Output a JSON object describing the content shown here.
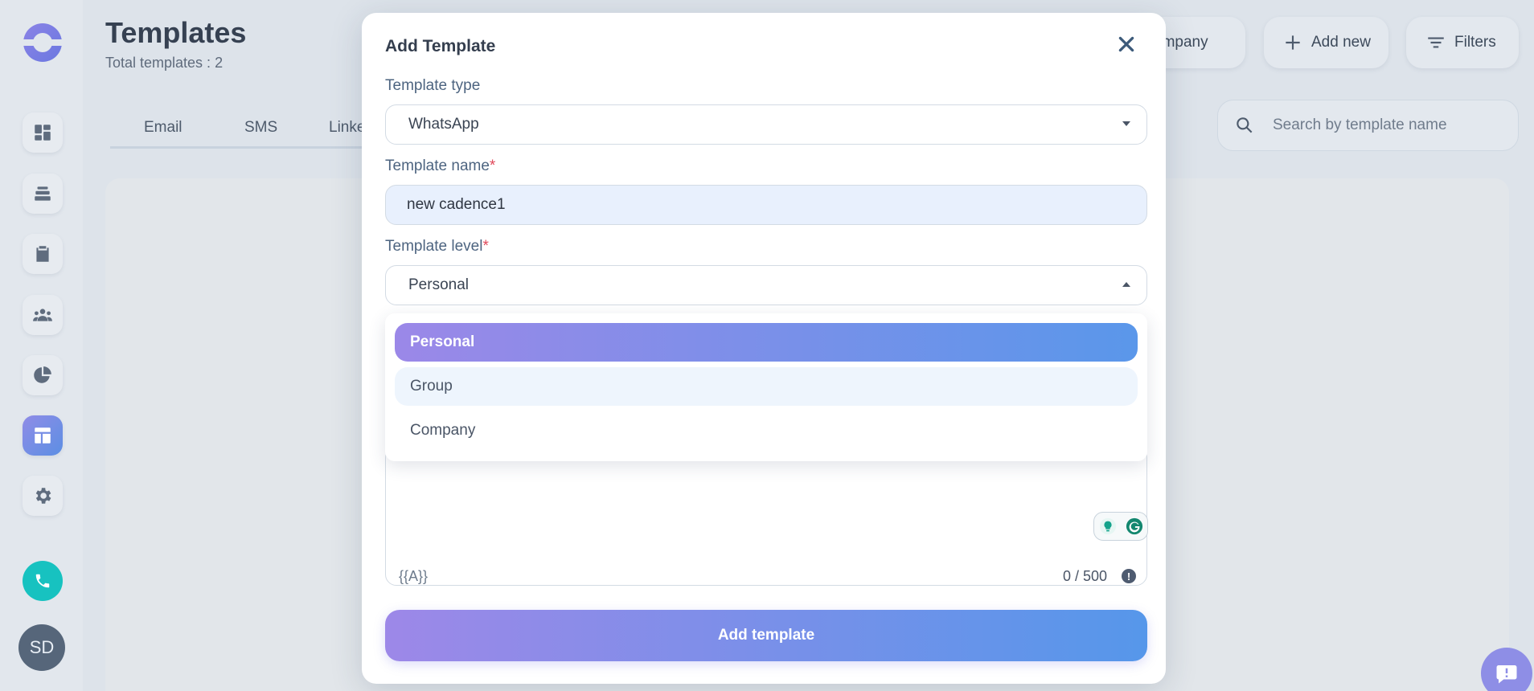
{
  "page": {
    "title": "Templates",
    "subtitle": "Total templates : 2",
    "tabs": [
      "Email",
      "SMS",
      "Linke"
    ]
  },
  "header": {
    "company_chip": "ompany",
    "add_new_label": "Add new",
    "filters_label": "Filters",
    "search_placeholder": "Search by template name"
  },
  "sidebar": {
    "avatar_initials": "SD",
    "items": [
      "dashboard-icon",
      "layers-icon",
      "clipboard-icon",
      "people-icon",
      "pie-chart-icon",
      "templates-icon",
      "gear-icon"
    ],
    "active_item": "templates-icon"
  },
  "modal": {
    "title": "Add Template",
    "template_type_label": "Template type",
    "template_type_value": "WhatsApp",
    "template_name_label": "Template name",
    "template_name_value": "new cadence1",
    "template_level_label": "Template level",
    "template_level_value": "Personal",
    "required_mark": "*",
    "level_options": [
      "Personal",
      "Group",
      "Company"
    ],
    "selected_option": "Personal",
    "variable_token": "{{A}}",
    "char_counter": "0 / 500",
    "submit_label": "Add template"
  },
  "colors": {
    "accent_start": "#9b88e8",
    "accent_end": "#5a97ea",
    "call_button": "#17c2c0",
    "required": "#e0495b"
  }
}
